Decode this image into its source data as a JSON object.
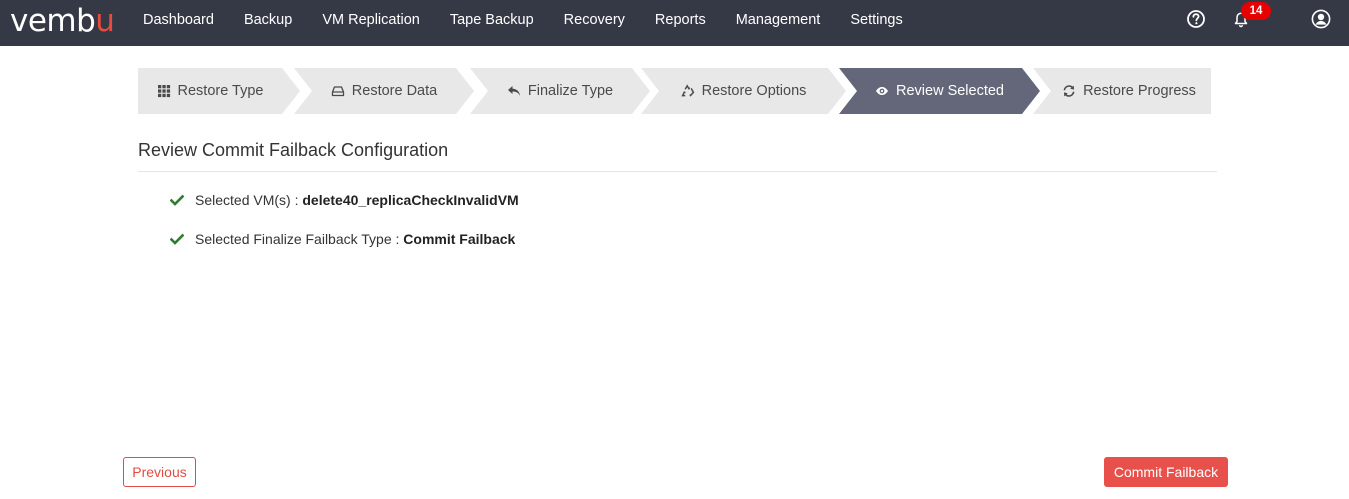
{
  "brand": {
    "logo_prefix": "vemb",
    "logo_accent": "u",
    "accent_color": "#e94b3c",
    "navbar_color": "#353946"
  },
  "nav": {
    "items": [
      "Dashboard",
      "Backup",
      "VM Replication",
      "Tape Backup",
      "Recovery",
      "Reports",
      "Management",
      "Settings"
    ],
    "notification_count": "14",
    "icons": [
      "help-icon",
      "bell-icon",
      "user-icon"
    ]
  },
  "wizard": {
    "active_index": 4,
    "active_color": "#636779",
    "inactive_color": "#e8e8e8",
    "steps": [
      {
        "label": "Restore Type",
        "icon": "grid-icon"
      },
      {
        "label": "Restore Data",
        "icon": "drive-icon"
      },
      {
        "label": "Finalize Type",
        "icon": "reply-icon"
      },
      {
        "label": "Restore Options",
        "icon": "recycle-icon"
      },
      {
        "label": "Review Selected",
        "icon": "eye-icon"
      },
      {
        "label": "Restore Progress",
        "icon": "refresh-icon"
      }
    ]
  },
  "review": {
    "title": "Review Commit Failback Configuration",
    "items": [
      {
        "label": "Selected VM(s) : ",
        "value": "delete40_replicaCheckInvalidVM"
      },
      {
        "label": "Selected Finalize Failback Type : ",
        "value": "Commit Failback"
      }
    ],
    "check_color": "#2e7d32"
  },
  "buttons": {
    "previous": "Previous",
    "commit": "Commit Failback"
  }
}
